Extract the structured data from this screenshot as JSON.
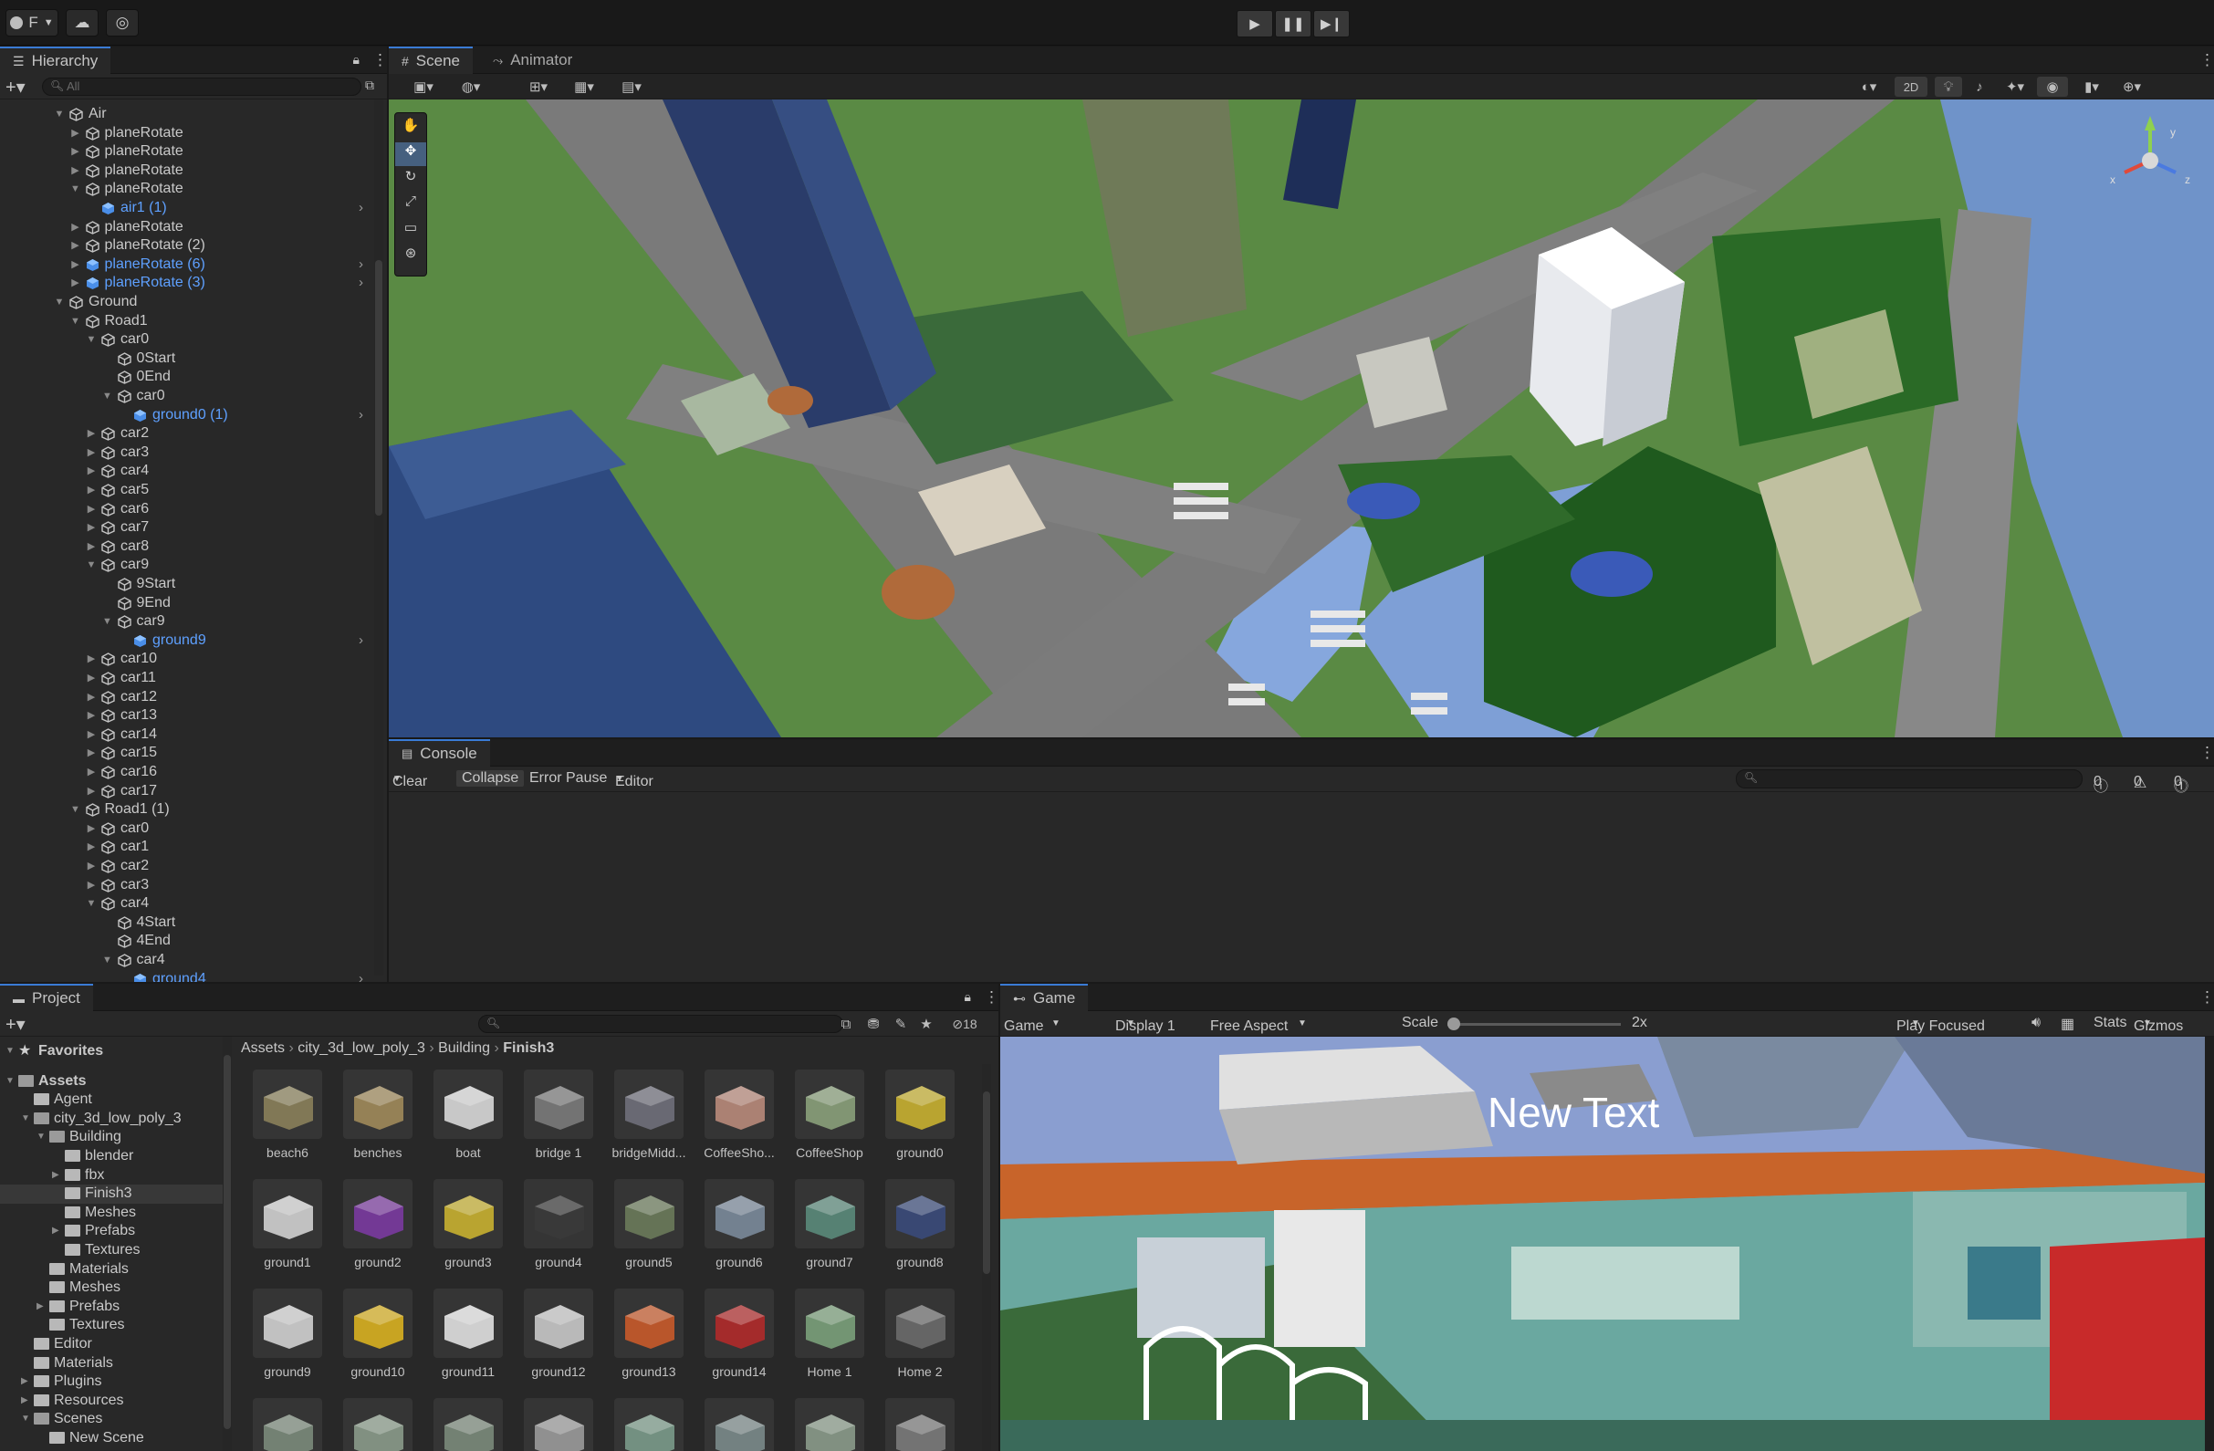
{
  "topbar": {
    "account_label": "F",
    "play_icon": "play-icon",
    "pause_icon": "pause-icon",
    "step_icon": "step-icon"
  },
  "hierarchy": {
    "tab_label": "Hierarchy",
    "search_placeholder": "All",
    "rows": [
      {
        "label": "Air",
        "depth": 0,
        "expanded": true,
        "kind": "object"
      },
      {
        "label": "planeRotate",
        "depth": 1,
        "expanded": false,
        "kind": "object"
      },
      {
        "label": "planeRotate",
        "depth": 1,
        "expanded": false,
        "kind": "object"
      },
      {
        "label": "planeRotate",
        "depth": 1,
        "expanded": false,
        "kind": "object"
      },
      {
        "label": "planeRotate",
        "depth": 1,
        "expanded": true,
        "kind": "object"
      },
      {
        "label": "air1 (1)",
        "depth": 2,
        "kind": "prefab",
        "more": true
      },
      {
        "label": "planeRotate",
        "depth": 1,
        "expanded": false,
        "kind": "object"
      },
      {
        "label": "planeRotate (2)",
        "depth": 1,
        "expanded": false,
        "kind": "object"
      },
      {
        "label": "planeRotate (6)",
        "depth": 1,
        "expanded": false,
        "kind": "prefab",
        "more": true
      },
      {
        "label": "planeRotate (3)",
        "depth": 1,
        "expanded": false,
        "kind": "prefab",
        "more": true
      },
      {
        "label": "Ground",
        "depth": 0,
        "expanded": true,
        "kind": "object"
      },
      {
        "label": "Road1",
        "depth": 1,
        "expanded": true,
        "kind": "object"
      },
      {
        "label": "car0",
        "depth": 2,
        "expanded": true,
        "kind": "object"
      },
      {
        "label": "0Start",
        "depth": 3,
        "kind": "object"
      },
      {
        "label": "0End",
        "depth": 3,
        "kind": "object"
      },
      {
        "label": "car0",
        "depth": 3,
        "expanded": true,
        "kind": "object"
      },
      {
        "label": "ground0 (1)",
        "depth": 4,
        "kind": "prefab",
        "more": true
      },
      {
        "label": "car2",
        "depth": 2,
        "expanded": false,
        "kind": "object"
      },
      {
        "label": "car3",
        "depth": 2,
        "expanded": false,
        "kind": "object"
      },
      {
        "label": "car4",
        "depth": 2,
        "expanded": false,
        "kind": "object"
      },
      {
        "label": "car5",
        "depth": 2,
        "expanded": false,
        "kind": "object"
      },
      {
        "label": "car6",
        "depth": 2,
        "expanded": false,
        "kind": "object"
      },
      {
        "label": "car7",
        "depth": 2,
        "expanded": false,
        "kind": "object"
      },
      {
        "label": "car8",
        "depth": 2,
        "expanded": false,
        "kind": "object"
      },
      {
        "label": "car9",
        "depth": 2,
        "expanded": true,
        "kind": "object"
      },
      {
        "label": "9Start",
        "depth": 3,
        "kind": "object"
      },
      {
        "label": "9End",
        "depth": 3,
        "kind": "object"
      },
      {
        "label": "car9",
        "depth": 3,
        "expanded": true,
        "kind": "object"
      },
      {
        "label": "ground9",
        "depth": 4,
        "kind": "prefab",
        "more": true
      },
      {
        "label": "car10",
        "depth": 2,
        "expanded": false,
        "kind": "object"
      },
      {
        "label": "car11",
        "depth": 2,
        "expanded": false,
        "kind": "object"
      },
      {
        "label": "car12",
        "depth": 2,
        "expanded": false,
        "kind": "object"
      },
      {
        "label": "car13",
        "depth": 2,
        "expanded": false,
        "kind": "object"
      },
      {
        "label": "car14",
        "depth": 2,
        "expanded": false,
        "kind": "object"
      },
      {
        "label": "car15",
        "depth": 2,
        "expanded": false,
        "kind": "object"
      },
      {
        "label": "car16",
        "depth": 2,
        "expanded": false,
        "kind": "object"
      },
      {
        "label": "car17",
        "depth": 2,
        "expanded": false,
        "kind": "object"
      },
      {
        "label": "Road1 (1)",
        "depth": 1,
        "expanded": true,
        "kind": "object"
      },
      {
        "label": "car0",
        "depth": 2,
        "expanded": false,
        "kind": "object"
      },
      {
        "label": "car1",
        "depth": 2,
        "expanded": false,
        "kind": "object"
      },
      {
        "label": "car2",
        "depth": 2,
        "expanded": false,
        "kind": "object"
      },
      {
        "label": "car3",
        "depth": 2,
        "expanded": false,
        "kind": "object"
      },
      {
        "label": "car4",
        "depth": 2,
        "expanded": true,
        "kind": "object"
      },
      {
        "label": "4Start",
        "depth": 3,
        "kind": "object"
      },
      {
        "label": "4End",
        "depth": 3,
        "kind": "object"
      },
      {
        "label": "car4",
        "depth": 3,
        "expanded": true,
        "kind": "object"
      },
      {
        "label": "ground4",
        "depth": 4,
        "kind": "prefab",
        "more": true
      }
    ]
  },
  "scene": {
    "tabs": [
      {
        "label": "Scene",
        "icon": "grid-icon"
      },
      {
        "label": "Animator",
        "icon": "animator-icon"
      }
    ],
    "mode_2d": "2D"
  },
  "console": {
    "tab_label": "Console",
    "clear": "Clear",
    "collapse": "Collapse",
    "error_pause": "Error Pause",
    "editor": "Editor",
    "info_count": "0",
    "warn_count": "0",
    "error_count": "0"
  },
  "project": {
    "tab_label": "Project",
    "hidden_count": "18",
    "breadcrumb": [
      "Assets",
      "city_3d_low_poly_3",
      "Building",
      "Finish3"
    ],
    "tree": [
      {
        "label": "Favorites",
        "depth": 0,
        "kind": "star",
        "bold": true,
        "arrow": "open"
      },
      {
        "label": "Assets",
        "depth": 0,
        "kind": "folder",
        "bold": true,
        "arrow": "open"
      },
      {
        "label": "Agent",
        "depth": 1,
        "kind": "folder",
        "arrow": "none"
      },
      {
        "label": "city_3d_low_poly_3",
        "depth": 1,
        "kind": "folder",
        "arrow": "open"
      },
      {
        "label": "Building",
        "depth": 2,
        "kind": "folder",
        "arrow": "open"
      },
      {
        "label": "blender",
        "depth": 3,
        "kind": "folder",
        "arrow": "none"
      },
      {
        "label": "fbx",
        "depth": 3,
        "kind": "folder",
        "arrow": "closed"
      },
      {
        "label": "Finish3",
        "depth": 3,
        "kind": "folder",
        "arrow": "none",
        "selected": true
      },
      {
        "label": "Meshes",
        "depth": 3,
        "kind": "folder",
        "arrow": "none"
      },
      {
        "label": "Prefabs",
        "depth": 3,
        "kind": "folder",
        "arrow": "closed"
      },
      {
        "label": "Textures",
        "depth": 3,
        "kind": "folder",
        "arrow": "none"
      },
      {
        "label": "Materials",
        "depth": 2,
        "kind": "folder",
        "arrow": "none"
      },
      {
        "label": "Meshes",
        "depth": 2,
        "kind": "folder",
        "arrow": "none"
      },
      {
        "label": "Prefabs",
        "depth": 2,
        "kind": "folder",
        "arrow": "closed"
      },
      {
        "label": "Textures",
        "depth": 2,
        "kind": "folder",
        "arrow": "none"
      },
      {
        "label": "Editor",
        "depth": 1,
        "kind": "folder",
        "arrow": "none"
      },
      {
        "label": "Materials",
        "depth": 1,
        "kind": "folder",
        "arrow": "none"
      },
      {
        "label": "Plugins",
        "depth": 1,
        "kind": "folder",
        "arrow": "closed"
      },
      {
        "label": "Resources",
        "depth": 1,
        "kind": "folder",
        "arrow": "closed"
      },
      {
        "label": "Scenes",
        "depth": 1,
        "kind": "folder",
        "arrow": "open"
      },
      {
        "label": "New Scene",
        "depth": 2,
        "kind": "folder",
        "arrow": "none"
      }
    ],
    "assets": [
      {
        "name": "beach6",
        "color": "#8a7f5a"
      },
      {
        "name": "benches",
        "color": "#a08a5a"
      },
      {
        "name": "boat",
        "color": "#d8d8d8"
      },
      {
        "name": "bridge 1",
        "color": "#7a7a7a"
      },
      {
        "name": "bridgeMidd...",
        "color": "#6f6f7a"
      },
      {
        "name": "CoffeeSho...",
        "color": "#b88a7a"
      },
      {
        "name": "CoffeeShop",
        "color": "#8aa07a"
      },
      {
        "name": "ground0",
        "color": "#c8b030"
      },
      {
        "name": "ground1",
        "color": "#d0d0d0"
      },
      {
        "name": "ground2",
        "color": "#7a3aa0"
      },
      {
        "name": "ground3",
        "color": "#c8b030"
      },
      {
        "name": "ground4",
        "color": "#3a3a3a"
      },
      {
        "name": "ground5",
        "color": "#6a7a5a"
      },
      {
        "name": "ground6",
        "color": "#7a8a9a"
      },
      {
        "name": "ground7",
        "color": "#5a8a7a"
      },
      {
        "name": "ground8",
        "color": "#3a4a7a"
      },
      {
        "name": "ground9",
        "color": "#d0d0d0"
      },
      {
        "name": "ground10",
        "color": "#d8b020"
      },
      {
        "name": "ground11",
        "color": "#e0e0e0"
      },
      {
        "name": "ground12",
        "color": "#c8c8c8"
      },
      {
        "name": "ground13",
        "color": "#c85a2a"
      },
      {
        "name": "ground14",
        "color": "#b02a2a"
      },
      {
        "name": "Home 1",
        "color": "#7aa07a"
      },
      {
        "name": "Home 2",
        "color": "#6a6a6a"
      },
      {
        "name": "",
        "color": "#7a8a7a"
      },
      {
        "name": "",
        "color": "#8a9a8a"
      },
      {
        "name": "",
        "color": "#7a8a7a"
      },
      {
        "name": "",
        "color": "#9a9a9a"
      },
      {
        "name": "",
        "color": "#7a9a8a"
      },
      {
        "name": "",
        "color": "#7a8a8a"
      },
      {
        "name": "",
        "color": "#8a9a8a"
      },
      {
        "name": "",
        "color": "#7a7a7a"
      }
    ]
  },
  "game": {
    "tab_label": "Game",
    "mode": "Game",
    "display": "Display 1",
    "aspect": "Free Aspect",
    "scale_label": "Scale",
    "scale_value": "2x",
    "play_focused": "Play Focused",
    "stats": "Stats",
    "gizmos": "Gizmos",
    "overlay_text": "New Text"
  },
  "colors": {
    "accent": "#3a7bd5",
    "prefab_blue": "#5ea0ff",
    "panel_bg": "#282828"
  }
}
